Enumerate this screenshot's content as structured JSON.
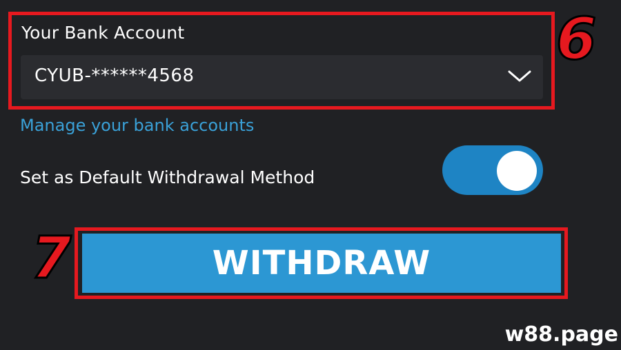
{
  "bank_account": {
    "label": "Your Bank Account",
    "selected_value": "CYUB-******4568",
    "dropdown_icon": "chevron-down-icon"
  },
  "manage_link": {
    "label": "Manage your bank accounts"
  },
  "default_method": {
    "label": "Set as Default Withdrawal Method",
    "toggle_on": true
  },
  "withdraw": {
    "label": "WITHDRAW"
  },
  "annotations": {
    "step_6": "6",
    "step_7": "7"
  },
  "watermark": "w88.page",
  "colors": {
    "background": "#202124",
    "select_background": "#2b2c30",
    "accent_blue": "#2c97d3",
    "toggle_blue": "#1e84c4",
    "link_blue": "#3aa1d8",
    "annotation_red": "#e6191f"
  }
}
